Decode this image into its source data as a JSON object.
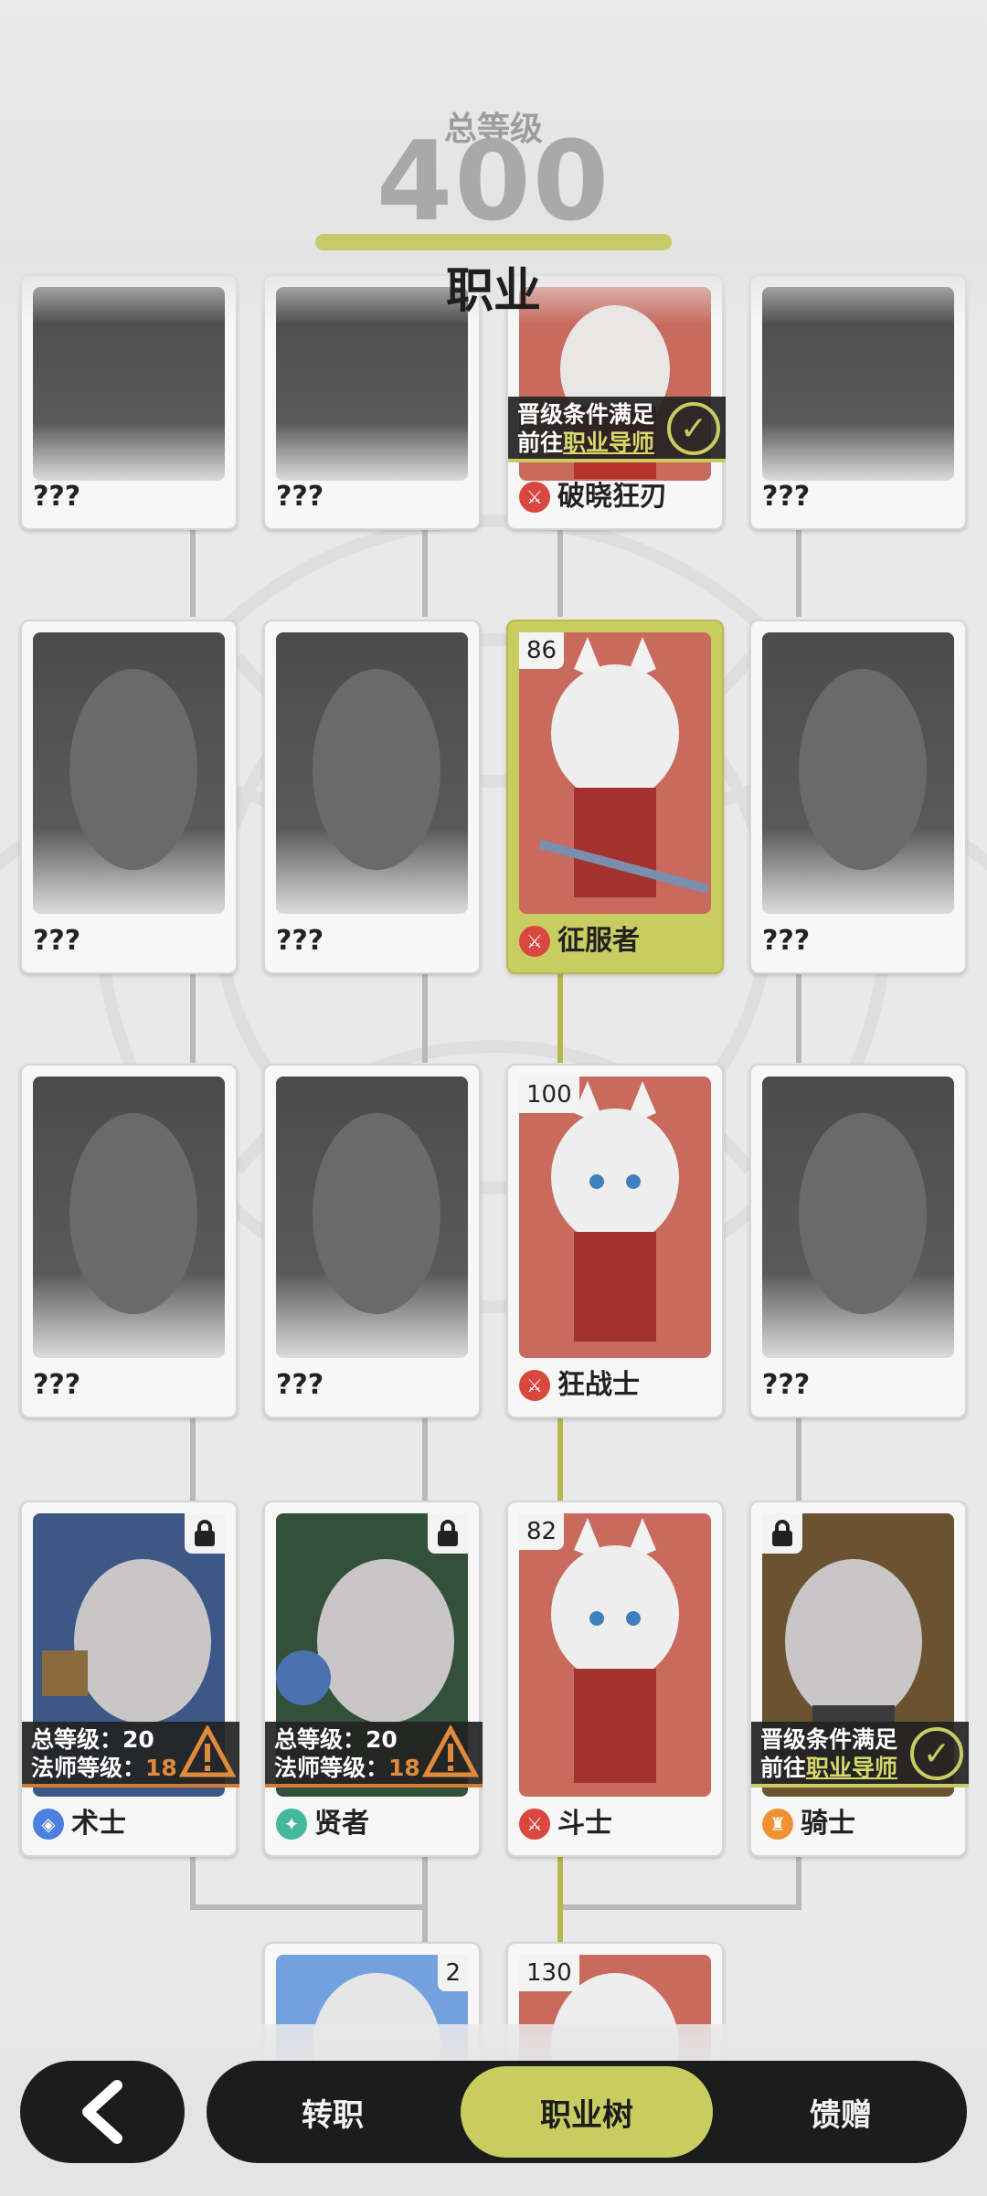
{
  "header": {
    "total_level_label": "总等级",
    "total_level_value": "400",
    "section_title": "职业"
  },
  "cards": {
    "row1": [
      {
        "name": "???"
      },
      {
        "name": "???"
      },
      {
        "name": "破晓狂刃",
        "banner_line1": "晋级条件满足",
        "banner_line2_prefix": "前往",
        "banner_line2_link": "职业导师"
      },
      {
        "name": "???"
      }
    ],
    "row2": [
      {
        "name": "???"
      },
      {
        "name": "???"
      },
      {
        "name": "征服者",
        "level": "86"
      },
      {
        "name": "???"
      }
    ],
    "row3": [
      {
        "name": "???"
      },
      {
        "name": "???"
      },
      {
        "name": "狂战士",
        "level": "100"
      },
      {
        "name": "???"
      }
    ],
    "row4": [
      {
        "name": "术士",
        "req1_label": "总等级：",
        "req1_value": "20",
        "req2_label": "法师等级：",
        "req2_value": "18"
      },
      {
        "name": "贤者",
        "req1_label": "总等级：",
        "req1_value": "20",
        "req2_label": "法师等级：",
        "req2_value": "18"
      },
      {
        "name": "斗士",
        "level": "82"
      },
      {
        "name": "骑士",
        "banner_line1": "晋级条件满足",
        "banner_line2_prefix": "前往",
        "banner_line2_link": "职业导师"
      }
    ],
    "row5": [
      {
        "level": "2"
      },
      {
        "level": "130"
      }
    ]
  },
  "nav": {
    "back_icon": "chevron-left-icon",
    "tabs": [
      "转职",
      "职业树",
      "馈赠"
    ],
    "active_tab": "职业树"
  },
  "colors": {
    "accent": "#c9cd61",
    "dark": "#1c1c1c",
    "warning": "#e08b3b"
  }
}
